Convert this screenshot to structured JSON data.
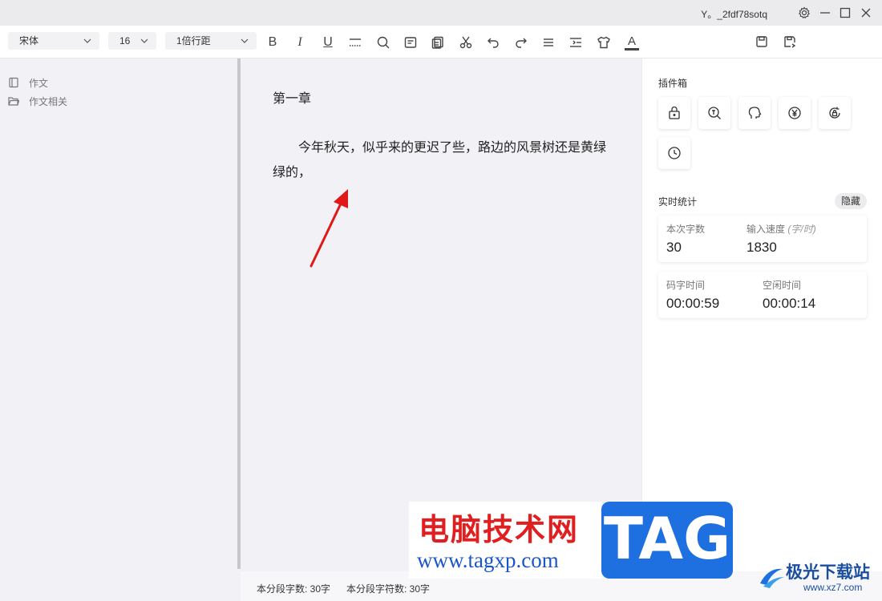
{
  "titlebar": {
    "username": "Y。_2fdf78sotq"
  },
  "toolbar": {
    "font_family": "宋体",
    "font_size": "16",
    "line_spacing": "1倍行距",
    "font_color_letter": "A",
    "bold_letter": "B",
    "italic_letter": "I",
    "underline_letter": "U",
    "icons": [
      "bold-icon",
      "italic-icon",
      "underline-icon",
      "divider-line-icon",
      "search-icon",
      "note-icon",
      "copy-icon",
      "cut-icon",
      "undo-icon",
      "redo-icon",
      "align-icon",
      "indent-icon",
      "theme-shirt-icon",
      "font-color-icon",
      "save-icon",
      "save-as-icon"
    ]
  },
  "sidebar": {
    "items": [
      {
        "label": "作文",
        "icon": "book-icon"
      },
      {
        "label": "作文相关",
        "icon": "folder-icon"
      }
    ]
  },
  "editor": {
    "chapter_title": "第一章",
    "paragraph": "今年秋天，似乎来的更迟了些，路边的风景树还是黄绿绿的，"
  },
  "statusbar": {
    "para_chars": "本分段字数: 30字",
    "para_symbols": "本分段字符数: 30字"
  },
  "plugins": {
    "title": "插件箱",
    "items": [
      "lock-icon",
      "word-search-icon",
      "head-icon",
      "yen-icon",
      "sync-lock-icon",
      "clock-icon"
    ]
  },
  "stats": {
    "title": "实时统计",
    "hide_label": "隐藏",
    "session_chars_label": "本次字数",
    "session_chars": "30",
    "speed_label": "输入速度",
    "speed_unit": "(字/时)",
    "speed": "1830",
    "typing_time_label": "码字时间",
    "typing_time": "00:00:59",
    "idle_time_label": "空闲时间",
    "idle_time": "00:00:14"
  },
  "watermark": {
    "site_cn": "电脑技术网",
    "site_url": "www.tagxp.com",
    "tag": "TAG",
    "logo_cn": "极光下载站",
    "logo_url": "www.xz7.com"
  },
  "colors": {
    "arrow": "#e01818",
    "watermark_red": "#e02020",
    "watermark_blue": "#1e6fe0"
  }
}
